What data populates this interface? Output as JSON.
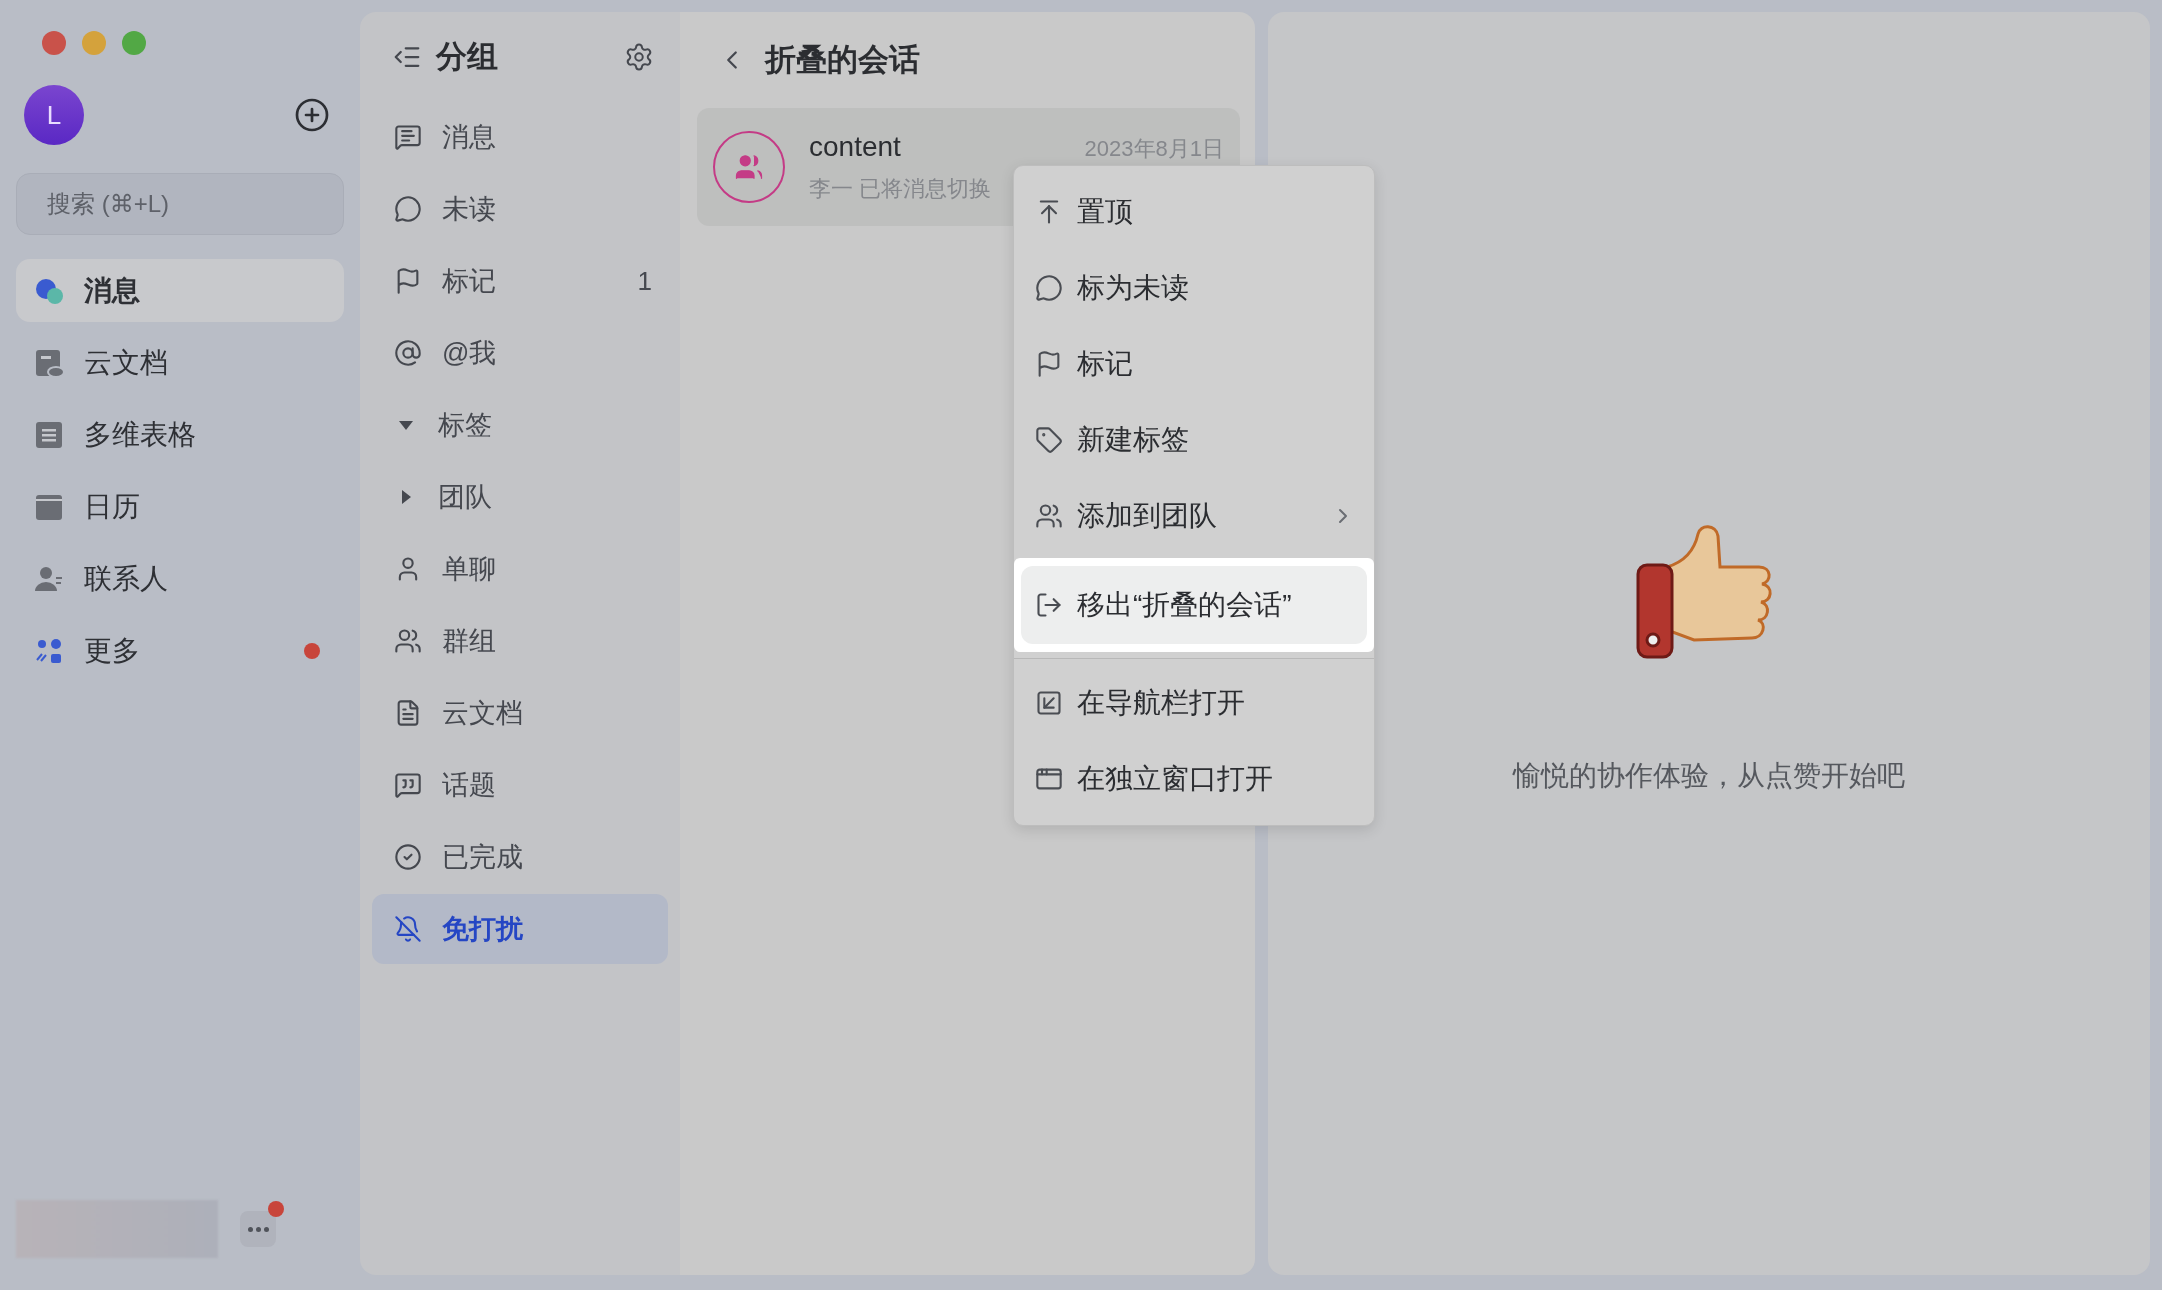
{
  "sidebar": {
    "avatar": "L",
    "search": {
      "placeholder": "搜索 (⌘+L)"
    },
    "items": [
      {
        "label": "消息",
        "selected": true,
        "dot": false
      },
      {
        "label": "云文档",
        "selected": false,
        "dot": false
      },
      {
        "label": "多维表格",
        "selected": false,
        "dot": false
      },
      {
        "label": "日历",
        "selected": false,
        "dot": false
      },
      {
        "label": "联系人",
        "selected": false,
        "dot": false
      },
      {
        "label": "更多",
        "selected": false,
        "dot": true
      }
    ],
    "footer": {
      "more_dot": true
    }
  },
  "groups": {
    "title": "分组",
    "items": [
      {
        "kind": "item",
        "label": "消息",
        "selected": false
      },
      {
        "kind": "item",
        "label": "未读",
        "selected": false
      },
      {
        "kind": "item",
        "label": "标记",
        "count": "1",
        "selected": false
      },
      {
        "kind": "item",
        "label": "@我",
        "selected": false
      },
      {
        "kind": "folder",
        "label": "标签",
        "expanded": true,
        "selected": false
      },
      {
        "kind": "folder",
        "label": "团队",
        "expanded": false,
        "selected": false
      },
      {
        "kind": "item",
        "label": "单聊",
        "selected": false
      },
      {
        "kind": "item",
        "label": "群组",
        "selected": false
      },
      {
        "kind": "item",
        "label": "云文档",
        "selected": false
      },
      {
        "kind": "item",
        "label": "话题",
        "selected": false
      },
      {
        "kind": "item",
        "label": "已完成",
        "selected": false
      },
      {
        "kind": "item",
        "label": "免打扰",
        "selected": true
      }
    ]
  },
  "conversation": {
    "title": "折叠的会话",
    "items": [
      {
        "name": "content",
        "time": "2023年8月1日",
        "preview": "李一 已将消息切换"
      }
    ]
  },
  "context_menu": {
    "sections": [
      [
        {
          "label": "置顶",
          "submenu": false,
          "selected": false
        },
        {
          "label": "标为未读",
          "submenu": false,
          "selected": false
        },
        {
          "label": "标记",
          "submenu": false,
          "selected": false
        },
        {
          "label": "新建标签",
          "submenu": false,
          "selected": false
        },
        {
          "label": "添加到团队",
          "submenu": true,
          "selected": false
        },
        {
          "label": "移出“折叠的会话”",
          "submenu": false,
          "selected": true
        }
      ],
      [
        {
          "label": "在导航栏打开",
          "submenu": false,
          "selected": false
        },
        {
          "label": "在独立窗口打开",
          "submenu": false,
          "selected": false
        }
      ]
    ]
  },
  "empty_state": {
    "message": "愉悦的协作体验，从点赞开始吧"
  }
}
